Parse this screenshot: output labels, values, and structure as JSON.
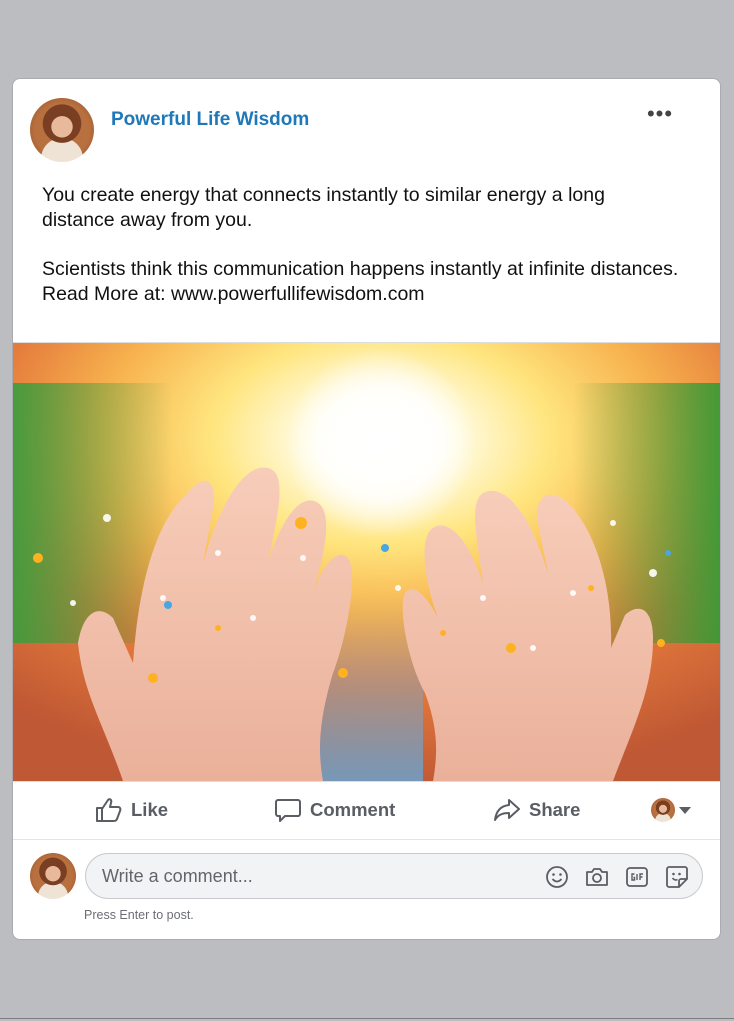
{
  "post": {
    "page_name": "Powerful Life Wisdom",
    "more_label": "•••",
    "paragraphs": [
      "You create energy that connects instantly to similar energy a long distance away from you.",
      "Scientists think this communication happens instantly at infinite distances.  Read More at: www.powerfullifewisdom.com"
    ],
    "image_icon": "open-hands-with-light-photo"
  },
  "actions": {
    "like": "Like",
    "comment": "Comment",
    "share": "Share"
  },
  "comment_box": {
    "placeholder": "Write a comment...",
    "hint": "Press Enter to post.",
    "tools": [
      "emoji-icon",
      "camera-icon",
      "gif-icon",
      "sticker-icon"
    ]
  },
  "colors": {
    "page_name": "#1f78b7",
    "background": "#bcbdc1",
    "action_text": "#5a5d63"
  }
}
